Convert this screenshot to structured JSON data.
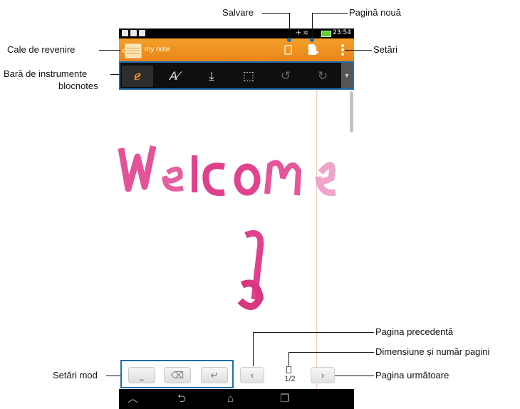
{
  "app": {
    "note_title": "my note",
    "status_time": "23:54",
    "page_count": "1/2"
  },
  "callouts": {
    "save": "Salvare",
    "new_page": "Pagină nouă",
    "return_path": "Cale de revenire",
    "settings": "Setări",
    "notebook_toolbar_line1": "Bară de instrumente",
    "notebook_toolbar_line2": "blocnotes",
    "previous_page": "Pagina precedentă",
    "page_size_count": "Dimensiune și număr pagini",
    "mode_settings": "Setări mod",
    "next_page": "Pagina următoare"
  },
  "canvas_text": "Welcome",
  "icons": [
    "back-chevron-icon",
    "note-icon",
    "save-icon",
    "new-page-icon",
    "menu-dots-icon",
    "pen-icon",
    "text-mode-icon",
    "insert-icon",
    "select-icon",
    "undo-icon",
    "redo-icon",
    "overflow-arrow-icon",
    "space-key-icon",
    "backspace-key-icon",
    "enter-key-icon",
    "previous-page-icon",
    "page-size-icon",
    "next-page-icon",
    "nav-home-icon",
    "nav-back-icon",
    "nav-recent-icon"
  ],
  "colors": {
    "action_bar": "#f0921e",
    "highlight": "#1d6eb0",
    "ink": "#e2438f"
  }
}
